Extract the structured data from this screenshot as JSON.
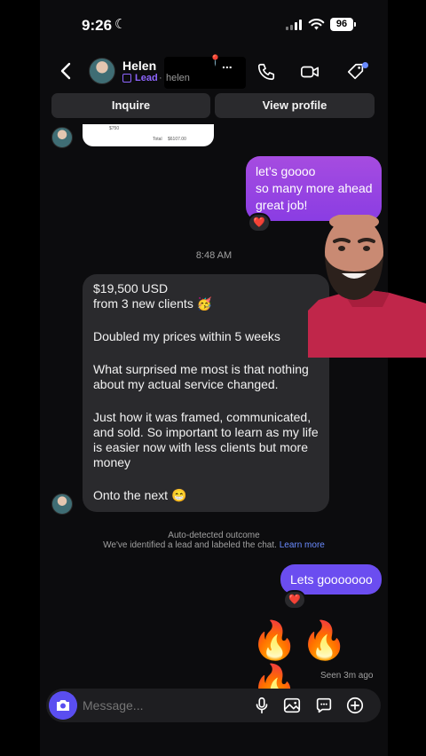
{
  "status_bar": {
    "time": "9:26",
    "battery": "96"
  },
  "header": {
    "name": "Helen",
    "more": "...",
    "label": "Lead",
    "separator": "·",
    "handle": "helen"
  },
  "actions": {
    "inquire": "Inquire",
    "view_profile": "View profile"
  },
  "preview": {
    "line1": "$750",
    "total_label": "Total",
    "total_value": "$6107.00"
  },
  "messages": {
    "sent_1": [
      "let’s goooo",
      "so many more ahead",
      "great job!"
    ],
    "reaction": "❤️",
    "timestamp": "8:48 AM",
    "received": {
      "p1": "$19,500 USD\nfrom 3 new clients 🥳",
      "p2": "Doubled my prices within 5 weeks",
      "p3": "What surprised me most is that nothing about my actual service changed.",
      "p4": "Just how it was framed, communicated, and sold.  So important to learn as my life is easier now with less clients but more money",
      "p5": "Onto the next 😁"
    },
    "auto_detected_title": "Auto-detected outcome",
    "auto_detected_text": "We've identified a lead and labeled the chat.",
    "learn_more": "Learn more",
    "sent_2": "Lets gooooooo",
    "fires": "🔥🔥🔥",
    "seen": "Seen 3m ago"
  },
  "composer": {
    "placeholder": "Message..."
  },
  "colors": {
    "accent": "#8a3de3",
    "lead": "#8e65ff",
    "link": "#6a8bff",
    "send_blue": "#6b4df0"
  }
}
